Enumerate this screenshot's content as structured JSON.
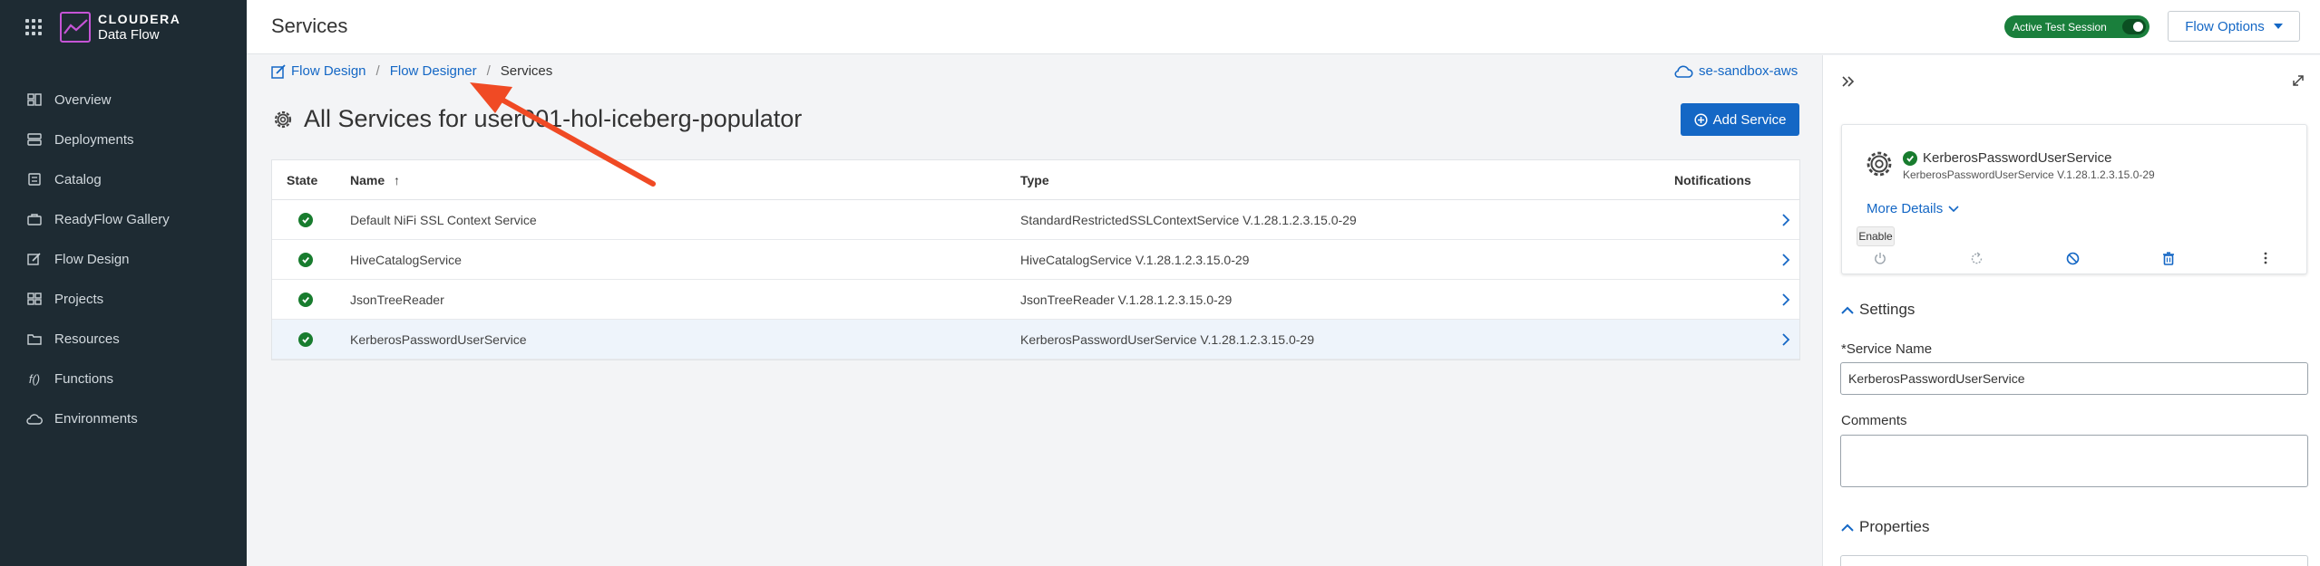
{
  "brand": {
    "name": "CLOUDERA",
    "product": "Data Flow"
  },
  "sidebar": {
    "items": [
      {
        "label": "Overview",
        "icon": "overview-icon"
      },
      {
        "label": "Deployments",
        "icon": "deployments-icon"
      },
      {
        "label": "Catalog",
        "icon": "catalog-icon"
      },
      {
        "label": "ReadyFlow Gallery",
        "icon": "readyflow-gallery-icon"
      },
      {
        "label": "Flow Design",
        "icon": "flow-design-icon"
      },
      {
        "label": "Projects",
        "icon": "projects-icon"
      },
      {
        "label": "Resources",
        "icon": "resources-icon"
      },
      {
        "label": "Functions",
        "icon": "functions-icon"
      },
      {
        "label": "Environments",
        "icon": "environments-icon"
      }
    ]
  },
  "header": {
    "title": "Services",
    "session_label": "Active Test Session",
    "flow_options_label": "Flow Options"
  },
  "breadcrumb": {
    "items": [
      "Flow Design",
      "Flow Designer",
      "Services"
    ],
    "separator": "/"
  },
  "environment": "se-sandbox-aws",
  "main": {
    "title": "All Services for user001-hol-iceberg-populator",
    "add_service_label": "Add Service"
  },
  "table": {
    "columns": {
      "state": "State",
      "name": "Name",
      "type": "Type",
      "notifications": "Notifications"
    },
    "sort_indicator": "↑",
    "rows": [
      {
        "state": "enabled",
        "name": "Default NiFi SSL Context Service",
        "type": "StandardRestrictedSSLContextService V.1.28.1.2.3.15.0-29"
      },
      {
        "state": "enabled",
        "name": "HiveCatalogService",
        "type": "HiveCatalogService V.1.28.1.2.3.15.0-29"
      },
      {
        "state": "enabled",
        "name": "JsonTreeReader",
        "type": "JsonTreeReader V.1.28.1.2.3.15.0-29"
      },
      {
        "state": "enabled",
        "name": "KerberosPasswordUserService",
        "type": "KerberosPasswordUserService V.1.28.1.2.3.15.0-29"
      }
    ]
  },
  "panel": {
    "service_name": "KerberosPasswordUserService",
    "service_type": "KerberosPasswordUserService V.1.28.1.2.3.15.0-29",
    "more_details_label": "More Details",
    "tooltip": "Enable",
    "settings_title": "Settings",
    "service_name_label": "*Service Name",
    "service_name_value": "KerberosPasswordUserService",
    "comments_label": "Comments",
    "properties_title": "Properties"
  },
  "colors": {
    "sidebar_bg": "#1e2b33",
    "accent": "#1467c5",
    "success": "#187c2e",
    "annotation_arrow": "#f04a24"
  }
}
